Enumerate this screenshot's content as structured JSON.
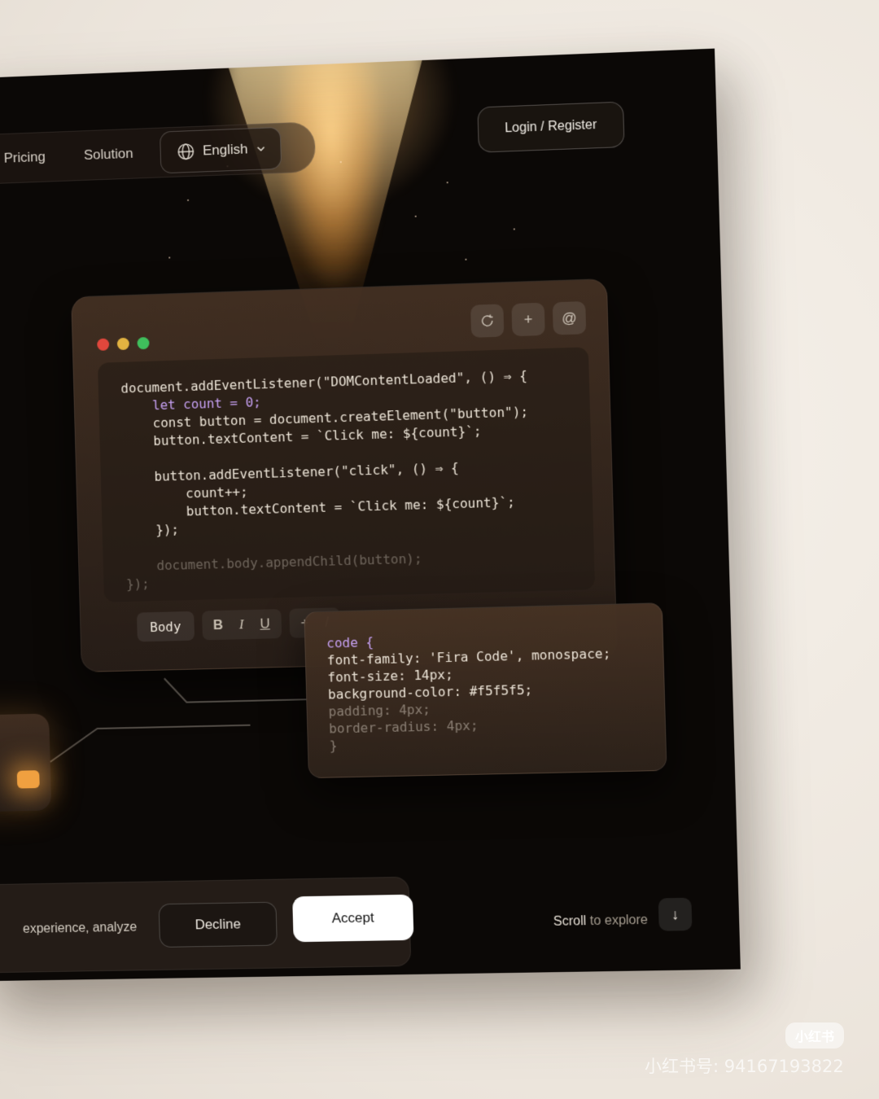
{
  "nav": {
    "links": [
      "Pricing",
      "Solution"
    ],
    "language": "English",
    "login_label": "Login / Register"
  },
  "editor": {
    "window_dots": [
      "#e0473c",
      "#e3b341",
      "#3fbf5c"
    ],
    "toolbar_icons": [
      "refresh-icon",
      "plus-icon",
      "at-icon"
    ],
    "code_lines": [
      "document.addEventListener(\"DOMContentLoaded\", () ⇒ {",
      "    let count = 0;",
      "    const button = document.createElement(\"button\");",
      "    button.textContent = `Click me: ${count}`;",
      "",
      "    button.addEventListener(\"click\", () ⇒ {",
      "        count++;",
      "        button.textContent = `Click me: ${count}`;",
      "    });",
      "",
      "    document.body.appendChild(button);",
      "});"
    ],
    "format_bar": {
      "style_label": "Body",
      "bold": "B",
      "italic": "I",
      "underline": "U",
      "add": "+",
      "slash": "/"
    }
  },
  "css_card": {
    "lines": [
      "code {",
      "font-family: 'Fira Code', monospace;",
      "font-size: 14px;",
      "background-color: #f5f5f5;",
      "padding: 4px;",
      "border-radius: 4px;",
      "}"
    ]
  },
  "cookie": {
    "text": "experience, analyze",
    "decline_label": "Decline",
    "accept_label": "Accept"
  },
  "scroll": {
    "strong": "Scroll",
    "dim": " to explore",
    "icon": "arrow-down-icon"
  },
  "watermark": {
    "logo": "小红书",
    "text": "小红书号: 94167193822"
  },
  "colors": {
    "accent_glow": "#f0a040",
    "background": "#0b0806",
    "code_keyword": "#c6a0f2",
    "code_method": "#9ab3f0"
  }
}
